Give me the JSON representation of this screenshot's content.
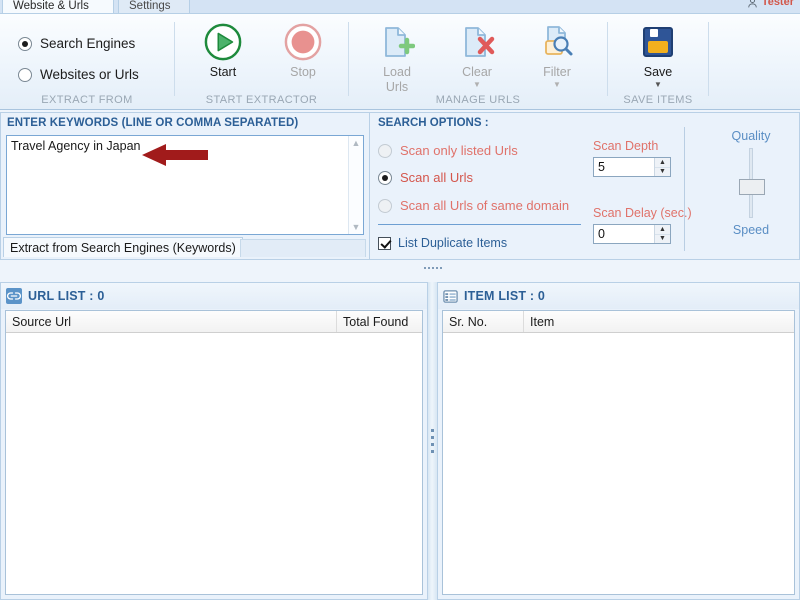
{
  "window": {
    "tabs": [
      {
        "label": "Website & Urls",
        "active": true
      },
      {
        "label": "Settings",
        "active": false
      }
    ],
    "user": {
      "name": "Tester",
      "icon": "user-icon"
    }
  },
  "ribbon": {
    "groups": [
      {
        "name": "extract-from",
        "label": "EXTRACT FROM",
        "options": [
          {
            "label": "Search Engines",
            "selected": true
          },
          {
            "label": "Websites or Urls",
            "selected": false
          }
        ]
      },
      {
        "name": "start-extractor",
        "label": "START EXTRACTOR",
        "buttons": [
          {
            "label": "Start",
            "icon": "play-circle-icon",
            "enabled": true,
            "color": "#1e8a3c"
          },
          {
            "label": "Stop",
            "icon": "stop-circle-icon",
            "enabled": false,
            "color": "#e08a8a"
          }
        ]
      },
      {
        "name": "manage-urls",
        "label": "MANAGE URLS",
        "buttons": [
          {
            "label": "Load\nUrls",
            "line1": "Load",
            "line2": "Urls",
            "icon": "file-plus-icon",
            "enabled": false,
            "dropdown": false
          },
          {
            "label": "Clear",
            "line1": "Clear",
            "line2": "",
            "icon": "file-x-icon",
            "enabled": false,
            "dropdown": true
          },
          {
            "label": "Filter",
            "line1": "Filter",
            "line2": "",
            "icon": "file-search-icon",
            "enabled": false,
            "dropdown": true
          }
        ]
      },
      {
        "name": "save-items",
        "label": "SAVE ITEMS",
        "buttons": [
          {
            "label": "Save",
            "line1": "Save",
            "line2": "",
            "icon": "floppy-disk-icon",
            "enabled": true,
            "dropdown": true
          }
        ]
      }
    ]
  },
  "keywords_panel": {
    "title": "ENTER KEYWORDS (LINE OR COMMA SEPARATED)",
    "value": "Travel Agency in Japan",
    "placeholder": "",
    "scroll_up_icon": "chevron-up-icon",
    "scroll_down_icon": "chevron-down-icon",
    "tab_label": "Extract from Search Engines (Keywords)",
    "annotation": {
      "type": "arrow-left",
      "color": "#a11b1b"
    }
  },
  "search_options": {
    "title": "SEARCH OPTIONS :",
    "radios": [
      {
        "label": "Scan only listed Urls",
        "selected": false,
        "enabled": false
      },
      {
        "label": "Scan all Urls",
        "selected": true,
        "enabled": true
      },
      {
        "label": "Scan all Urls of same domain",
        "selected": false,
        "enabled": false
      }
    ],
    "checkbox": {
      "label": "List Duplicate Items",
      "checked": true
    },
    "scan_depth": {
      "label": "Scan Depth",
      "value": "5"
    },
    "scan_delay": {
      "label": "Scan Delay (sec.)",
      "value": "0"
    },
    "slider": {
      "top_label": "Quality",
      "bottom_label": "Speed",
      "position_pct": 45
    },
    "accent_color": "#e0726a",
    "heading_color": "#2c5f96"
  },
  "url_list": {
    "title": "URL LIST : 0",
    "icon": "link-icon",
    "columns": [
      "Source Url",
      "Total Found"
    ],
    "rows": []
  },
  "item_list": {
    "title": "ITEM LIST : 0",
    "icon": "grid-icon",
    "columns": [
      "Sr. No.",
      "Item"
    ],
    "rows": []
  }
}
